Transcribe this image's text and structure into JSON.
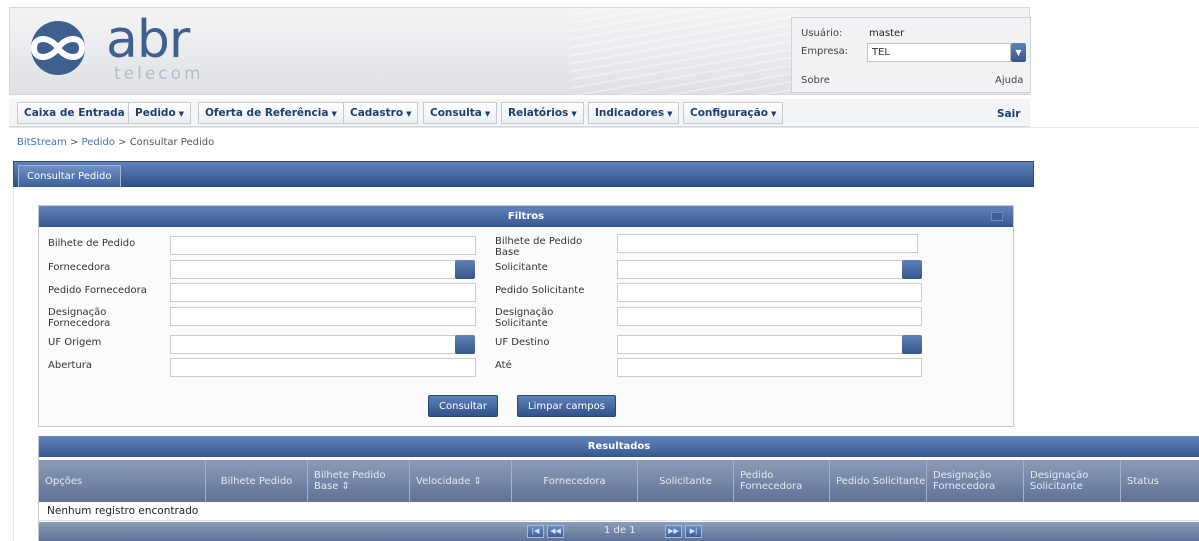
{
  "header": {
    "logo_text": "abr",
    "logo_subtext": "telecom",
    "user_label": "Usuário:",
    "user_value": "master",
    "company_label": "Empresa:",
    "company_value": "TEL",
    "about_link": "Sobre",
    "help_link": "Ajuda"
  },
  "menu": {
    "items": [
      {
        "label": "Caixa de Entrada",
        "caret": false
      },
      {
        "label": "Pedido",
        "caret": true
      },
      {
        "label": "Oferta de Referência",
        "caret": true
      },
      {
        "label": "Cadastro",
        "caret": true
      },
      {
        "label": "Consulta",
        "caret": true
      },
      {
        "label": "Relatórios",
        "caret": true
      },
      {
        "label": "Indicadores",
        "caret": true
      },
      {
        "label": "Configuração",
        "caret": true
      }
    ],
    "logout": "Sair"
  },
  "breadcrumb": {
    "items": [
      "BitStream",
      "Pedido",
      "Consultar Pedido"
    ],
    "separator": ">"
  },
  "tab": {
    "label": "Consultar Pedido"
  },
  "filters": {
    "title": "Filtros",
    "labels": {
      "bilhete_pedido": "Bilhete de Pedido",
      "bilhete_pedido_base": "Bilhete de Pedido Base",
      "fornecedora": "Fornecedora",
      "solicitante": "Solicitante",
      "pedido_fornecedora": "Pedido Fornecedora",
      "pedido_solicitante": "Pedido Solicitante",
      "designacao_fornecedora": "Designação Fornecedora",
      "designacao_solicitante": "Designação Solicitante",
      "uf_origem": "UF Origem",
      "uf_destino": "UF Destino",
      "abertura": "Abertura",
      "ate": "Até"
    },
    "buttons": {
      "search": "Consultar",
      "clear": "Limpar campos"
    }
  },
  "results": {
    "title": "Resultados",
    "columns": [
      "Opções",
      "Bilhete Pedido",
      "Bilhete Pedido Base ⇕",
      "Velocidade ⇕",
      "Fornecedora",
      "Solicitante",
      "Pedido Fornecedora",
      "Pedido Solicitante",
      "Designação Fornecedora",
      "Designação Solicitante",
      "Status"
    ],
    "empty_message": "Nenhum registro encontrado",
    "pager": {
      "text": "1 de 1"
    }
  },
  "colors": {
    "primary_blue": "#37588f",
    "menu_text": "#1e3e72",
    "table_header": "#5f7297"
  }
}
